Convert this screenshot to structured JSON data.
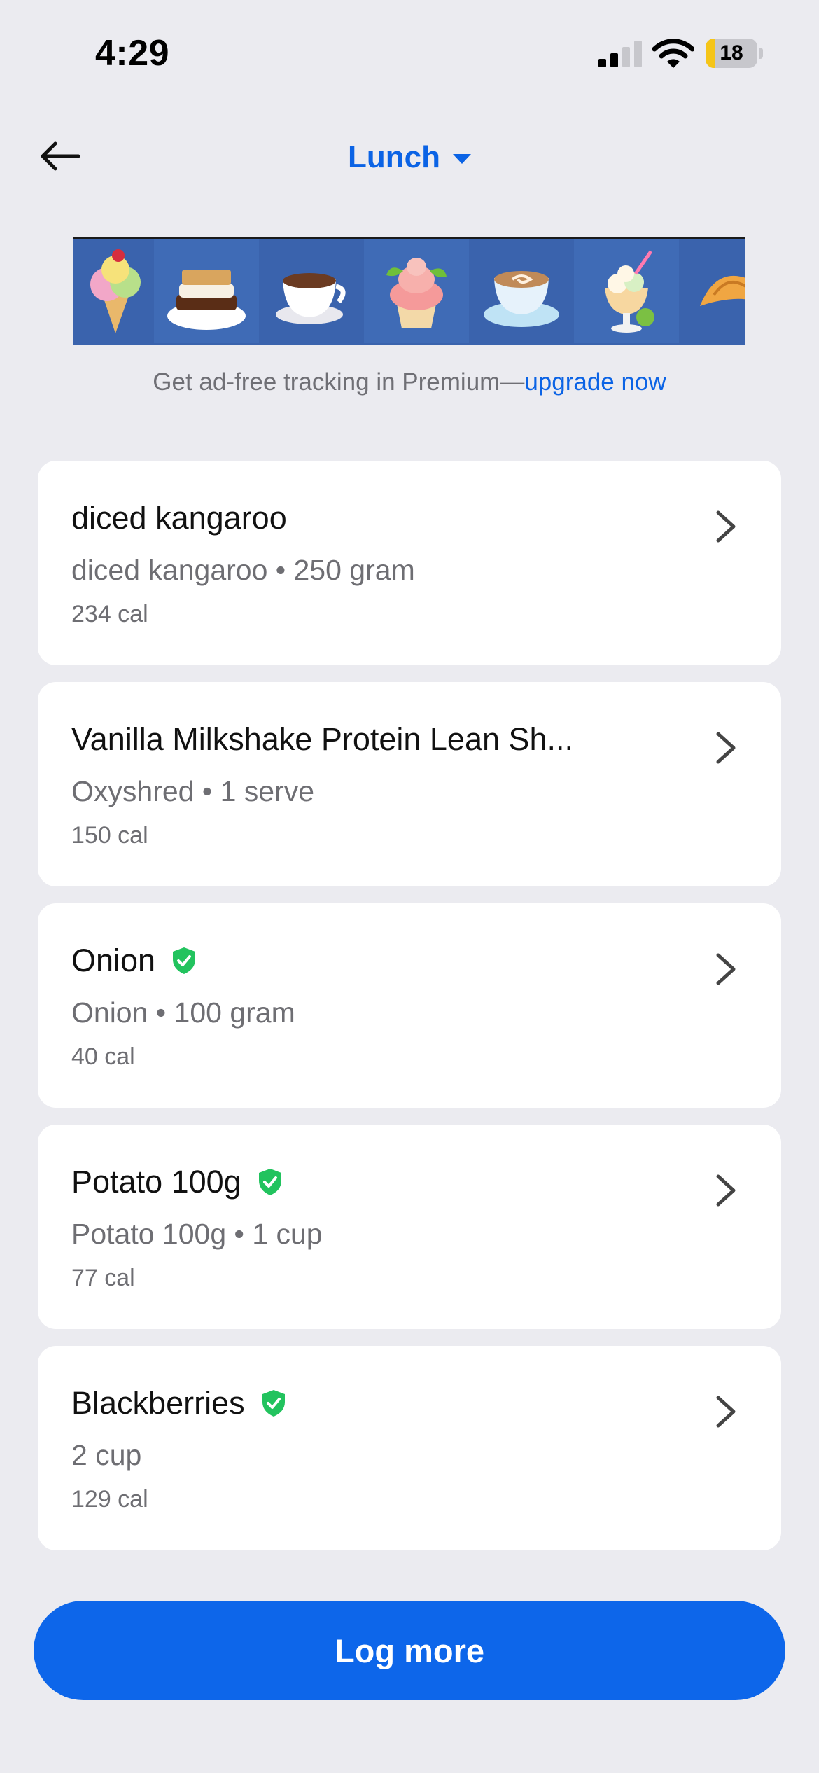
{
  "status_bar": {
    "time": "4:29",
    "battery_level": "18",
    "battery_fraction": 0.18,
    "signal_icon": "cellular-signal-icon",
    "wifi_icon": "wifi-icon"
  },
  "header": {
    "back_icon": "arrow-left-icon",
    "meal_title": "Lunch",
    "meal_caret_icon": "caret-down-icon"
  },
  "ad": {
    "tiles": [
      "ice-cream-icon",
      "smores-icon",
      "coffee-cup-icon",
      "cupcake-icon",
      "latte-icon",
      "sundae-icon",
      "croissant-icon"
    ]
  },
  "premium": {
    "prefix": "Get ad-free tracking in Premium—",
    "link": "upgrade now"
  },
  "foods": [
    {
      "name": "diced kangaroo",
      "detail": "diced kangaroo • 250 gram",
      "calories": "234 cal",
      "verified": false
    },
    {
      "name": "Vanilla Milkshake Protein Lean Sh...",
      "detail": "Oxyshred • 1 serve",
      "calories": "150 cal",
      "verified": false
    },
    {
      "name": "Onion",
      "detail": "Onion • 100 gram",
      "calories": "40 cal",
      "verified": true
    },
    {
      "name": "Potato 100g",
      "detail": "Potato 100g • 1 cup",
      "calories": "77 cal",
      "verified": true
    },
    {
      "name": "Blackberries",
      "detail": "2 cup",
      "calories": "129 cal",
      "verified": true
    }
  ],
  "actions": {
    "log_more": "Log more"
  },
  "colors": {
    "accent": "#0b63e5",
    "verified": "#22c35e",
    "background": "#ebebf0"
  }
}
